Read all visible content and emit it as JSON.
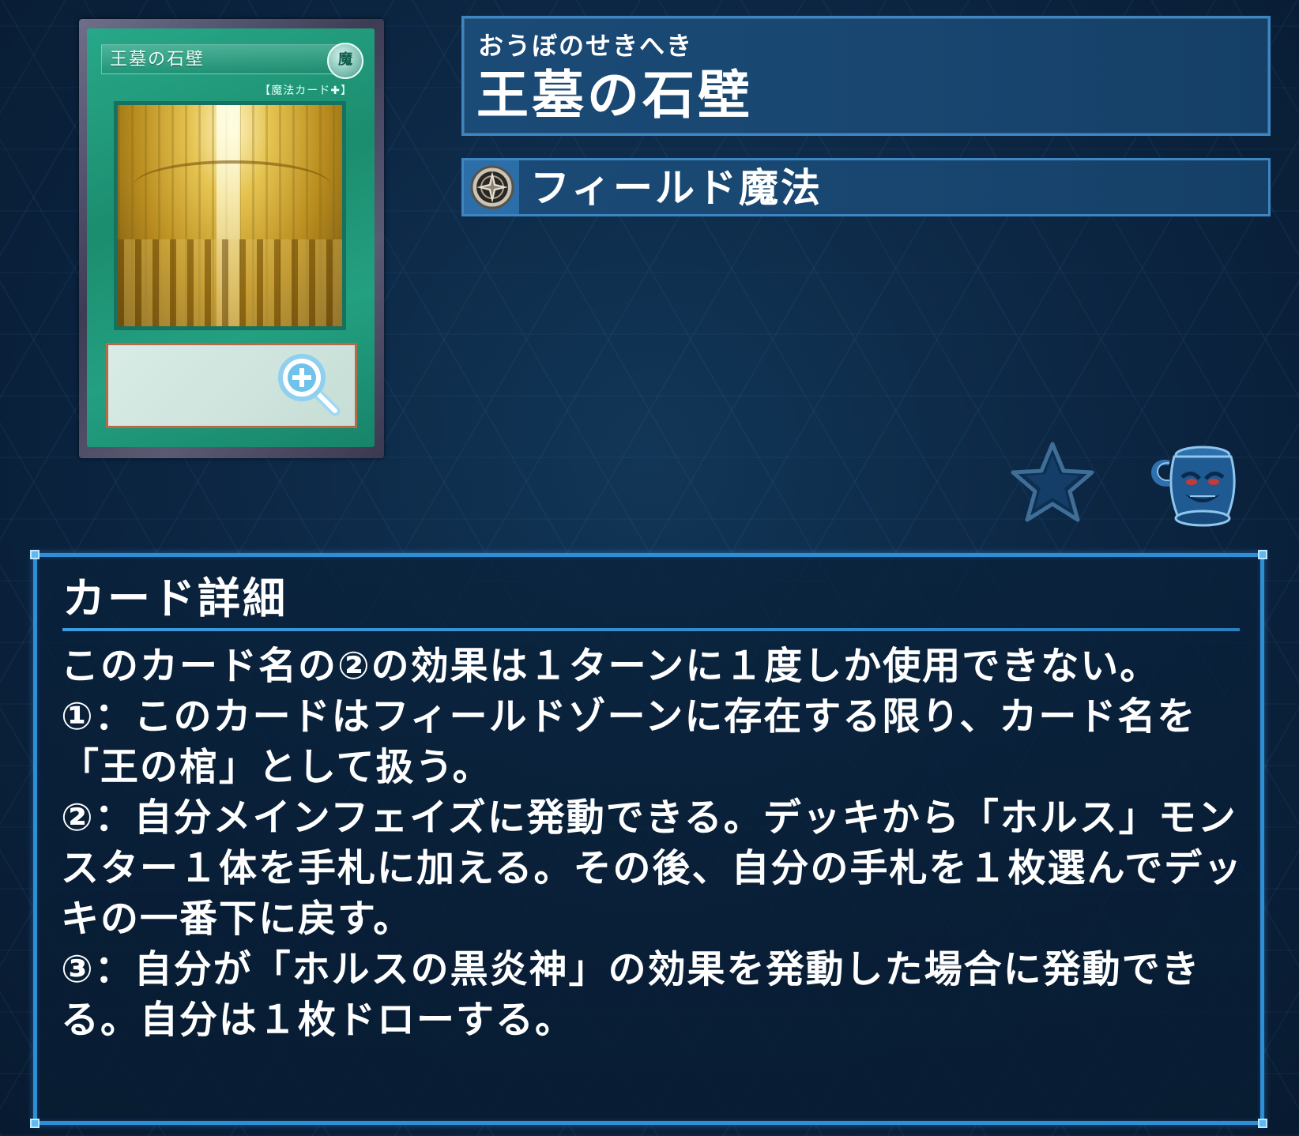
{
  "card": {
    "image_name": "王墓の石壁",
    "image_attribute": "魔",
    "image_type_line": "【魔法カード✚】",
    "ruby": "おうぼのせきへき",
    "name": "王墓の石壁",
    "type_label": "フィールド魔法",
    "type_icon": "field-spell-icon"
  },
  "actions": {
    "zoom_icon": "zoom-in-icon",
    "favorite_icon": "star-icon",
    "pot_icon": "pot-of-greed-icon"
  },
  "details": {
    "title": "カード詳細",
    "lines": [
      "このカード名の②の効果は１ターンに１度しか使用できない。",
      "①：このカードはフィールドゾーンに存在する限り、カード名を「王の棺」として扱う。",
      "②：自分メインフェイズに発動できる。デッキから「ホルス」モンスター１体を手札に加える。その後、自分の手札を１枚選んでデッキの一番下に戻す。",
      "③：自分が「ホルスの黒炎神」の効果を発動した場合に発動できる。自分は１枚ドローする。"
    ]
  },
  "colors": {
    "background": "#0b2440",
    "plate": "#184670",
    "plate_border": "#3d86c2",
    "panel_border": "#2f8fd6",
    "card_green": "#1c8d6f"
  }
}
